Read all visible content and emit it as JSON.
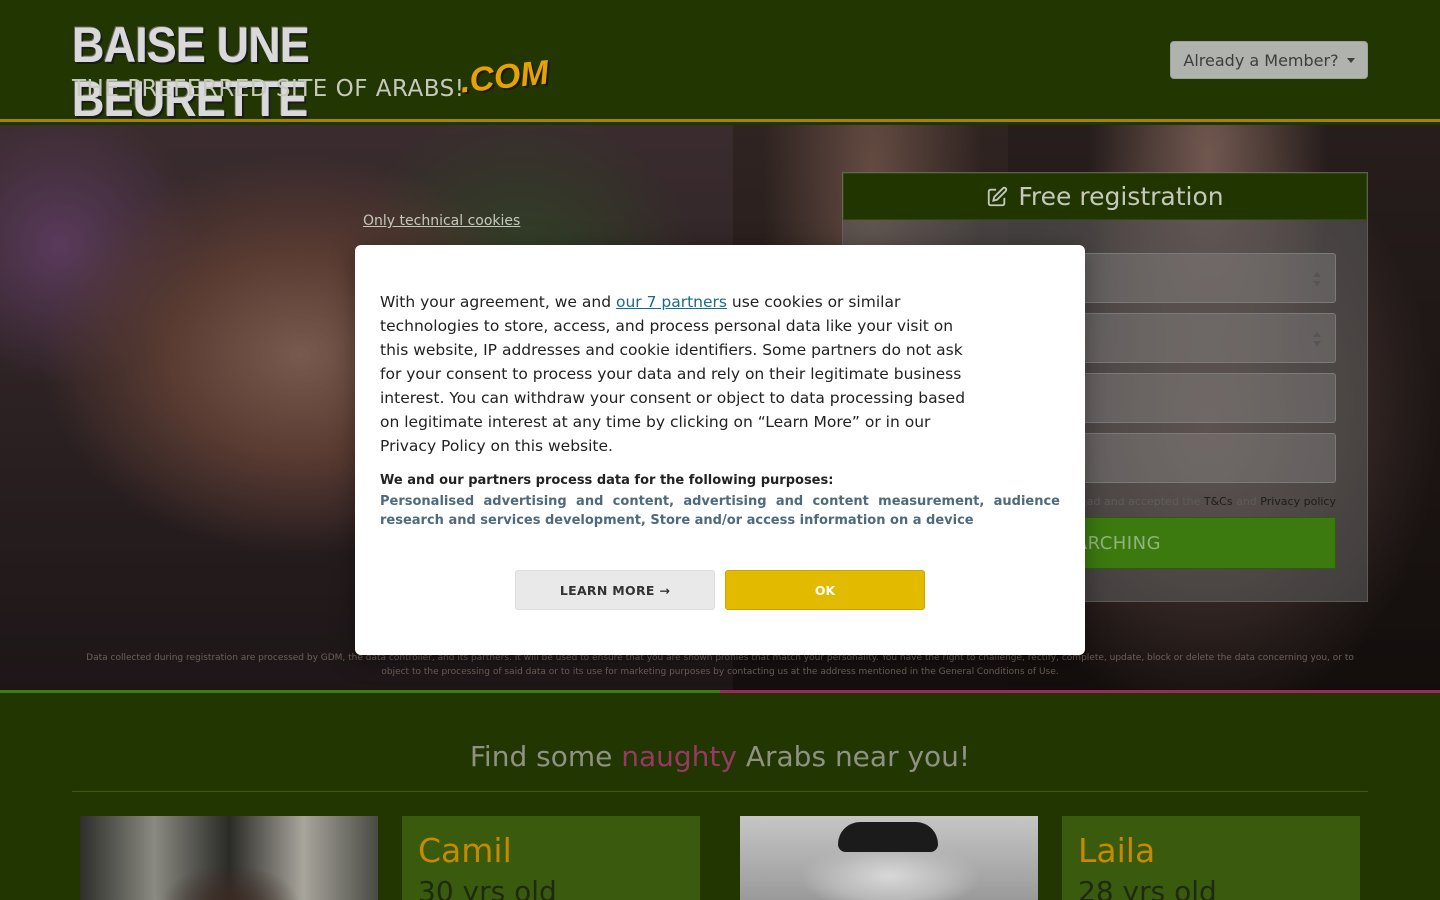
{
  "header": {
    "logo_main": "BAISE UNE BEURETTE",
    "logo_suffix": ".COM",
    "tagline": "THE PREFERRED SITE OF ARABS!",
    "member_button": "Already a Member?"
  },
  "registration": {
    "title": "Free registration",
    "terms_prefix": "I have read and accepted the",
    "terms_link": "T&Cs",
    "terms_and": "and",
    "privacy_link": "Privacy policy",
    "submit_label": "SEARCHING"
  },
  "legal_notice": "Data collected during registration are processed by GDM, the data controller, and its partners. It will be used to ensure that you are shown profiles that match your personality. You have the right to challenge, rectify, complete, update, block or delete the data concerning you, or to object to the processing of said data or to its use for marketing purposes by contacting us at the address mentioned in the General Conditions of Use.",
  "cookie": {
    "technical_link": "Only technical cookies",
    "intro_before": "With your agreement, we and ",
    "partners_link": "our 7 partners",
    "intro_after": " use cookies or similar technologies to store, access, and process personal data like your visit on this website, IP addresses and cookie identifiers. Some partners do not ask for your consent to process your data and rely on their legitimate business interest. You can withdraw your consent or object to data processing based on legitimate interest at any time by clicking on “Learn More” or in our Privacy Policy on this website.",
    "purposes_title": "We and our partners process data for the following purposes:",
    "purposes_list": "Personalised advertising and content, advertising and content measurement, audience research and services development, Store and/or access information on a device",
    "learn_more": "LEARN MORE →",
    "ok": "OK"
  },
  "find": {
    "before": "Find some ",
    "highlight": "naughty",
    "after": " Arabs near you!"
  },
  "profiles": [
    {
      "name": "Camil",
      "age": "30 yrs old"
    },
    {
      "name": "Laila",
      "age": "28 yrs old"
    }
  ],
  "colors": {
    "page_bg": "#213600",
    "accent_gold": "#a38500",
    "ok_button": "#e2bb00",
    "search_button": "#3c7a10",
    "highlight_pink": "#963a62",
    "profile_name": "#c68a00"
  }
}
